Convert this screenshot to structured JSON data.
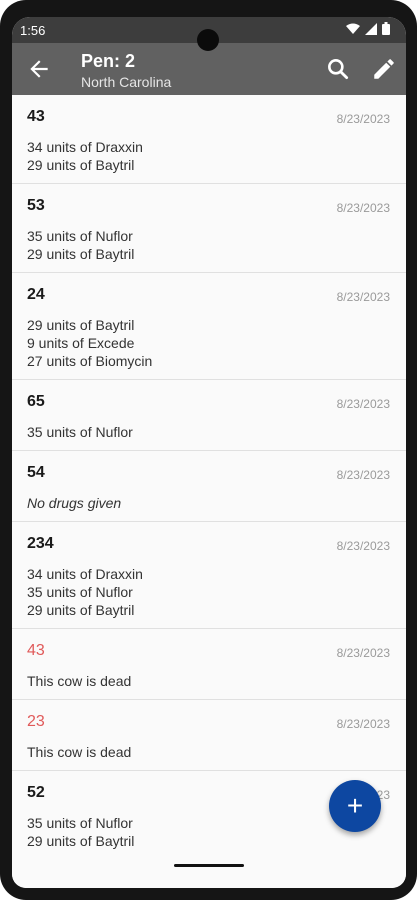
{
  "status": {
    "time": "1:56"
  },
  "appbar": {
    "title": "Pen: 2",
    "subtitle": "North Carolina"
  },
  "records": [
    {
      "id": "43",
      "date": "8/23/2023",
      "lines": [
        "34 units of Draxxin",
        "29 units of Baytril"
      ],
      "dead": false
    },
    {
      "id": "53",
      "date": "8/23/2023",
      "lines": [
        "35 units of Nuflor",
        "29 units of Baytril"
      ],
      "dead": false
    },
    {
      "id": "24",
      "date": "8/23/2023",
      "lines": [
        "29 units of Baytril",
        "9 units of Excede",
        "27 units of Biomycin"
      ],
      "dead": false
    },
    {
      "id": "65",
      "date": "8/23/2023",
      "lines": [
        "35 units of Nuflor"
      ],
      "dead": false
    },
    {
      "id": "54",
      "date": "8/23/2023",
      "lines": [
        "No drugs given"
      ],
      "dead": false,
      "italic": true
    },
    {
      "id": "234",
      "date": "8/23/2023",
      "lines": [
        "34 units of Draxxin",
        "35 units of Nuflor",
        "29 units of Baytril"
      ],
      "dead": false
    },
    {
      "id": "43",
      "date": "8/23/2023",
      "lines": [
        "This cow is dead"
      ],
      "dead": true
    },
    {
      "id": "23",
      "date": "8/23/2023",
      "lines": [
        "This cow is dead"
      ],
      "dead": true
    },
    {
      "id": "52",
      "date": "8/23/2023",
      "lines": [
        "35 units of Nuflor",
        "29 units of Baytril"
      ],
      "dead": false
    }
  ],
  "fab": {
    "label": "+"
  },
  "colors": {
    "appbar": "#616161",
    "fab": "#0d47a1",
    "dead_id": "#e05a5a"
  }
}
